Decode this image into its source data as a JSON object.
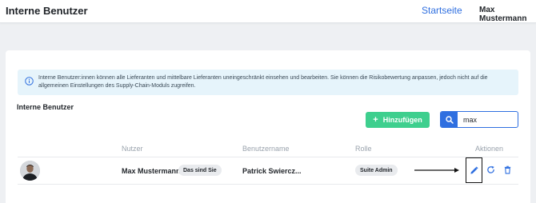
{
  "header": {
    "title": "Interne Benutzer",
    "home_link": "Startseite",
    "user_name": "Max Mustermann"
  },
  "info_banner": {
    "icon": "info-circle-icon",
    "text": "Interne Benutzer:innen können alle Lieferanten und mittelbare Lieferanten uneingeschränkt einsehen und bearbeiten. Sie können die Risikobewertung anpassen, jedoch nicht auf die allgemeinen Einstellungen des Supply-Chain-Moduls zugreifen."
  },
  "section": {
    "title": "Interne Benutzer",
    "add_button": "Hinzufügen",
    "search_value": "max"
  },
  "table": {
    "columns": [
      "Nutzer",
      "Benutzername",
      "Rolle",
      "Aktionen"
    ],
    "rows": [
      {
        "name": "Max Mustermann",
        "self_badge": "Das sind Sie",
        "username": "Patrick Swiercz...",
        "role": "Suite Admin"
      }
    ]
  },
  "colors": {
    "accent": "#2f6fe0",
    "add_button": "#3ecf8e",
    "info_background": "#e6f4fb",
    "page_background": "#eef0f3"
  },
  "icons": {
    "edit": "pencil-icon",
    "refresh": "refresh-icon",
    "delete": "trash-icon",
    "search": "search-icon",
    "annotation": "arrow-right-icon"
  }
}
